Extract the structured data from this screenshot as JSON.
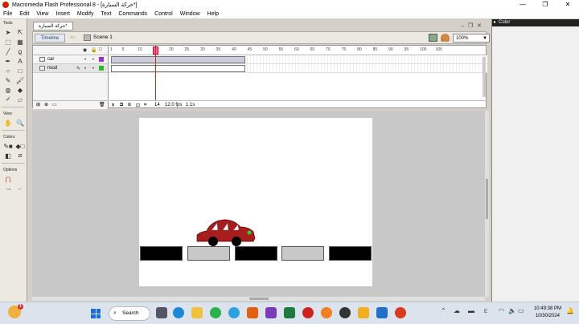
{
  "window": {
    "title": "Macromedia Flash Professional 8 - [حركة السيارة*]",
    "minimize": "—",
    "restore": "❐",
    "close": "✕"
  },
  "menu": [
    "File",
    "Edit",
    "View",
    "Insert",
    "Modify",
    "Text",
    "Commands",
    "Control",
    "Window",
    "Help"
  ],
  "tools": {
    "header": "Tools",
    "view_header": "View",
    "colors_header": "Colors",
    "options_header": "Options"
  },
  "document": {
    "tab": "حركة السيارة*",
    "timeline_button": "Timeline",
    "scene": "Scene 1",
    "zoom": "100%"
  },
  "timeline": {
    "layers": [
      {
        "name": "car",
        "color": "#9b2fc8",
        "selected": false
      },
      {
        "name": "roud",
        "color": "#2fb52f",
        "selected": true
      }
    ],
    "ruler": [
      "1",
      "5",
      "10",
      "15",
      "20",
      "25",
      "30",
      "35",
      "40",
      "45",
      "50",
      "55",
      "60",
      "65",
      "70",
      "75",
      "80",
      "85",
      "90",
      "95",
      "100",
      "105"
    ],
    "current_frame": "14",
    "frame_rate": "12.0 fps",
    "elapsed": "1.1s"
  },
  "stage": {
    "road_colors": [
      "#000000",
      "#c8c8c8",
      "#000000",
      "#c8c8c8",
      "#000000"
    ],
    "car_color": "#a81e1e"
  },
  "panels": {
    "color": "Color"
  },
  "taskbar": {
    "weather_badge": "1",
    "search": "Search",
    "time": "10:49:38 PM",
    "date": "10/30/2024",
    "lang": "E"
  }
}
